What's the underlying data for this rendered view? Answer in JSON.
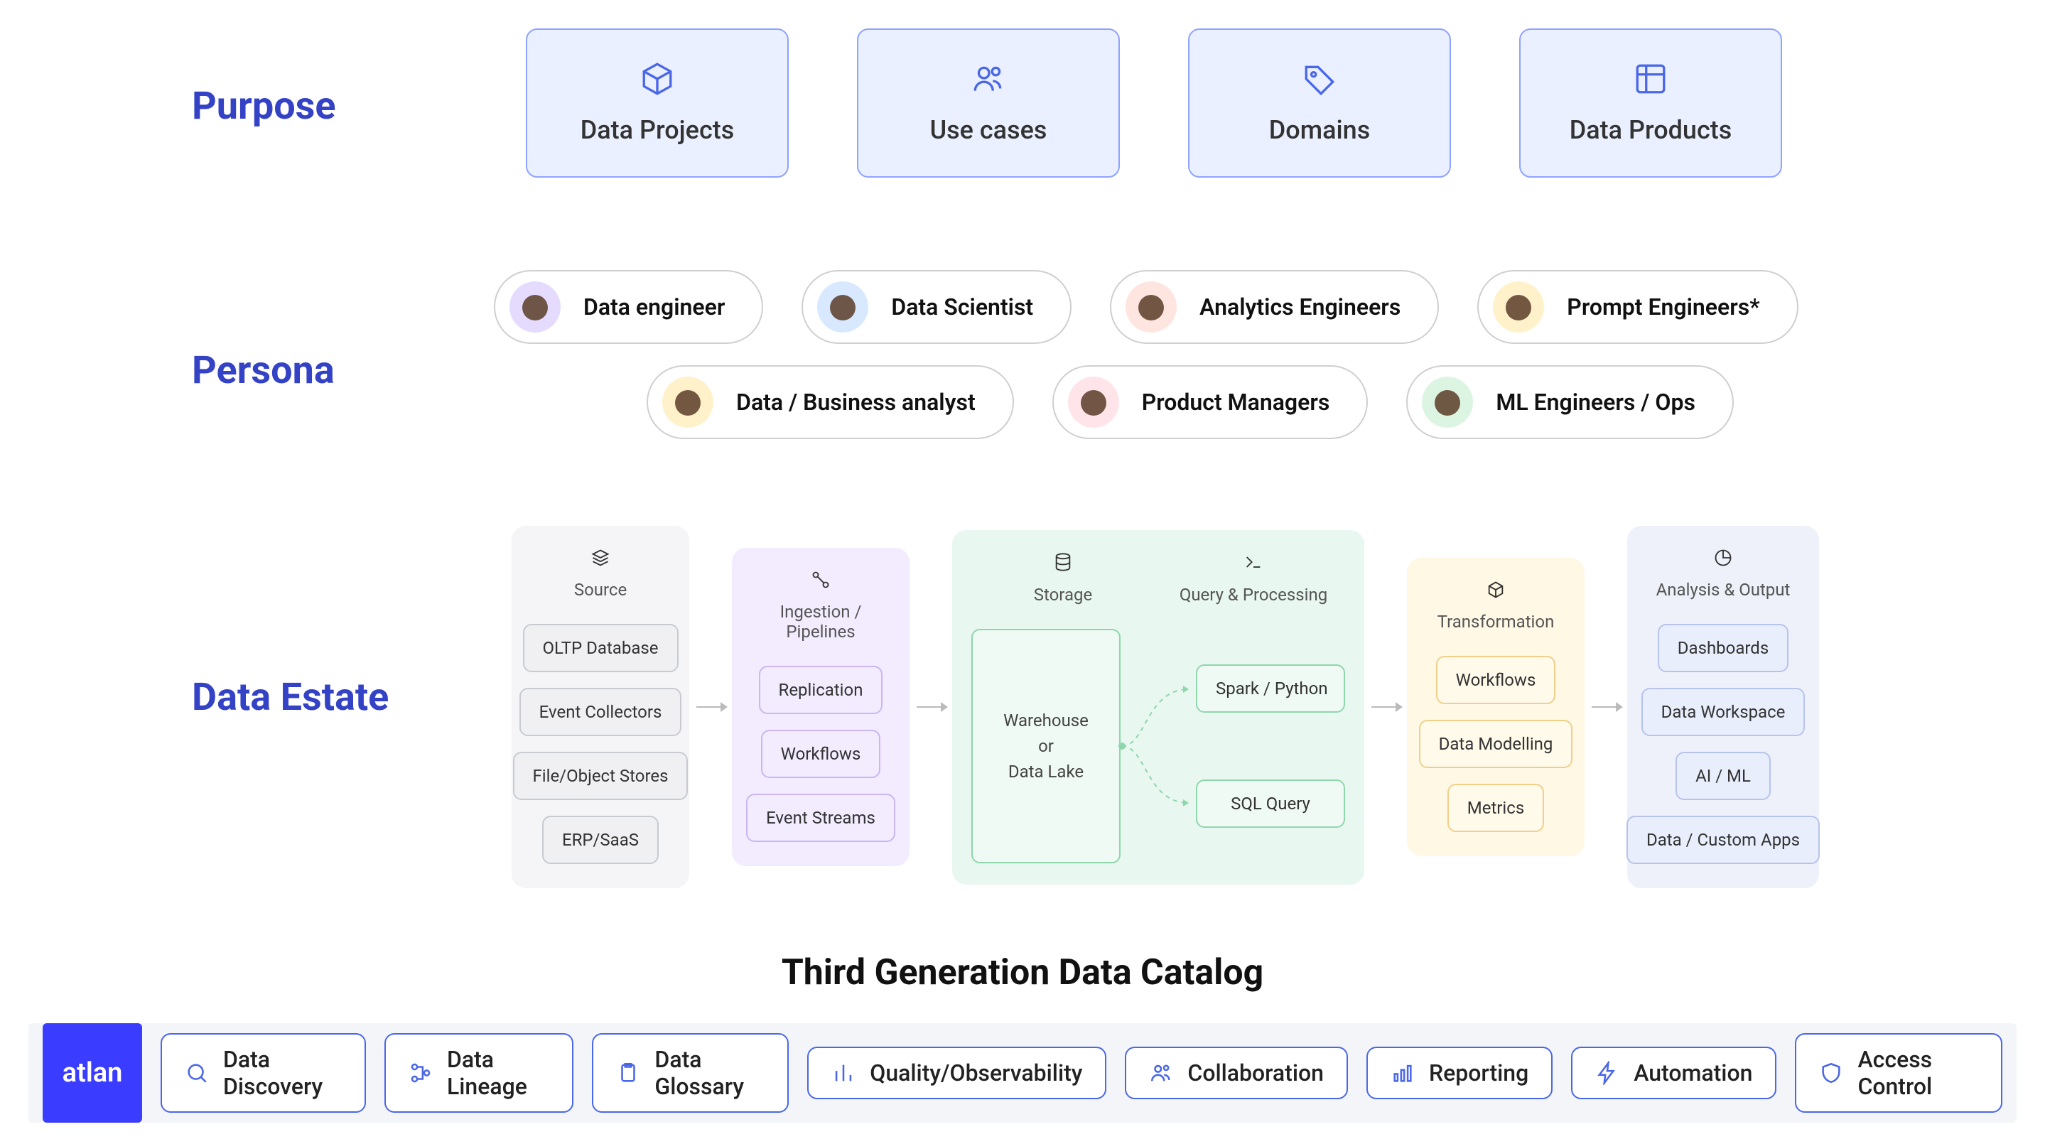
{
  "sections": {
    "purpose": "Purpose",
    "persona": "Persona",
    "estate": "Data Estate"
  },
  "purpose": [
    {
      "icon": "cube-icon",
      "label": "Data Projects"
    },
    {
      "icon": "users-icon",
      "label": "Use cases"
    },
    {
      "icon": "tag-icon",
      "label": "Domains"
    },
    {
      "icon": "grid-icon",
      "label": "Data Products"
    }
  ],
  "personas_row1": [
    {
      "label": "Data engineer"
    },
    {
      "label": "Data Scientist"
    },
    {
      "label": "Analytics Engineers"
    },
    {
      "label": "Prompt Engineers*"
    }
  ],
  "personas_row2": [
    {
      "label": "Data / Business analyst"
    },
    {
      "label": "Product Managers"
    },
    {
      "label": "ML Engineers / Ops"
    }
  ],
  "estate": {
    "source": {
      "title": "Source",
      "items": [
        "OLTP Database",
        "Event Collectors",
        "File/Object Stores",
        "ERP/SaaS"
      ]
    },
    "ingest": {
      "title": "Ingestion / Pipelines",
      "items": [
        "Replication",
        "Workflows",
        "Event Streams"
      ]
    },
    "storage": {
      "title": "Storage",
      "big": "Warehouse\nor\nData Lake"
    },
    "query": {
      "title": "Query & Processing",
      "items": [
        "Spark / Python",
        "SQL Query"
      ]
    },
    "transform": {
      "title": "Transformation",
      "items": [
        "Workflows",
        "Data Modelling",
        "Metrics"
      ]
    },
    "output": {
      "title": "Analysis & Output",
      "items": [
        "Dashboards",
        "Data Workspace",
        "AI / ML",
        "Data / Custom Apps"
      ]
    }
  },
  "catalog_title": "Third Generation Data Catalog",
  "brand": "atlan",
  "features": [
    {
      "icon": "search-icon",
      "label": "Data Discovery"
    },
    {
      "icon": "branch-icon",
      "label": "Data Lineage"
    },
    {
      "icon": "clipboard-icon",
      "label": "Data Glossary"
    },
    {
      "icon": "bars-icon",
      "label": "Quality/Observability"
    },
    {
      "icon": "people-icon",
      "label": "Collaboration"
    },
    {
      "icon": "chart-icon",
      "label": "Reporting"
    },
    {
      "icon": "bolt-icon",
      "label": "Automation"
    },
    {
      "icon": "shield-icon",
      "label": "Access Control"
    }
  ],
  "colors": {
    "blue": "#3442c6",
    "accent": "#4a67e8"
  }
}
